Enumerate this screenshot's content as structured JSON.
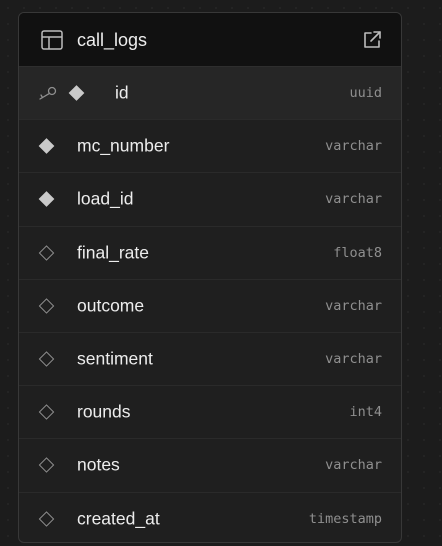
{
  "table": {
    "name": "call_logs",
    "columns": [
      {
        "name": "id",
        "type": "uuid",
        "primary_key": true,
        "marker": "filled"
      },
      {
        "name": "mc_number",
        "type": "varchar",
        "primary_key": false,
        "marker": "filled"
      },
      {
        "name": "load_id",
        "type": "varchar",
        "primary_key": false,
        "marker": "filled"
      },
      {
        "name": "final_rate",
        "type": "float8",
        "primary_key": false,
        "marker": "outline"
      },
      {
        "name": "outcome",
        "type": "varchar",
        "primary_key": false,
        "marker": "outline"
      },
      {
        "name": "sentiment",
        "type": "varchar",
        "primary_key": false,
        "marker": "outline"
      },
      {
        "name": "rounds",
        "type": "int4",
        "primary_key": false,
        "marker": "outline"
      },
      {
        "name": "notes",
        "type": "varchar",
        "primary_key": false,
        "marker": "outline"
      },
      {
        "name": "created_at",
        "type": "timestamp",
        "primary_key": false,
        "marker": "outline"
      }
    ]
  },
  "icons": {
    "table": "table-icon",
    "open": "external-link-icon",
    "key": "key-icon",
    "not_null": "diamond-filled-icon",
    "nullable": "diamond-outline-icon"
  },
  "colors": {
    "background": "#1c1c1c",
    "card": "#1f1f1f",
    "header": "#111111",
    "text": "#ededed",
    "muted": "#8f8f8f"
  }
}
